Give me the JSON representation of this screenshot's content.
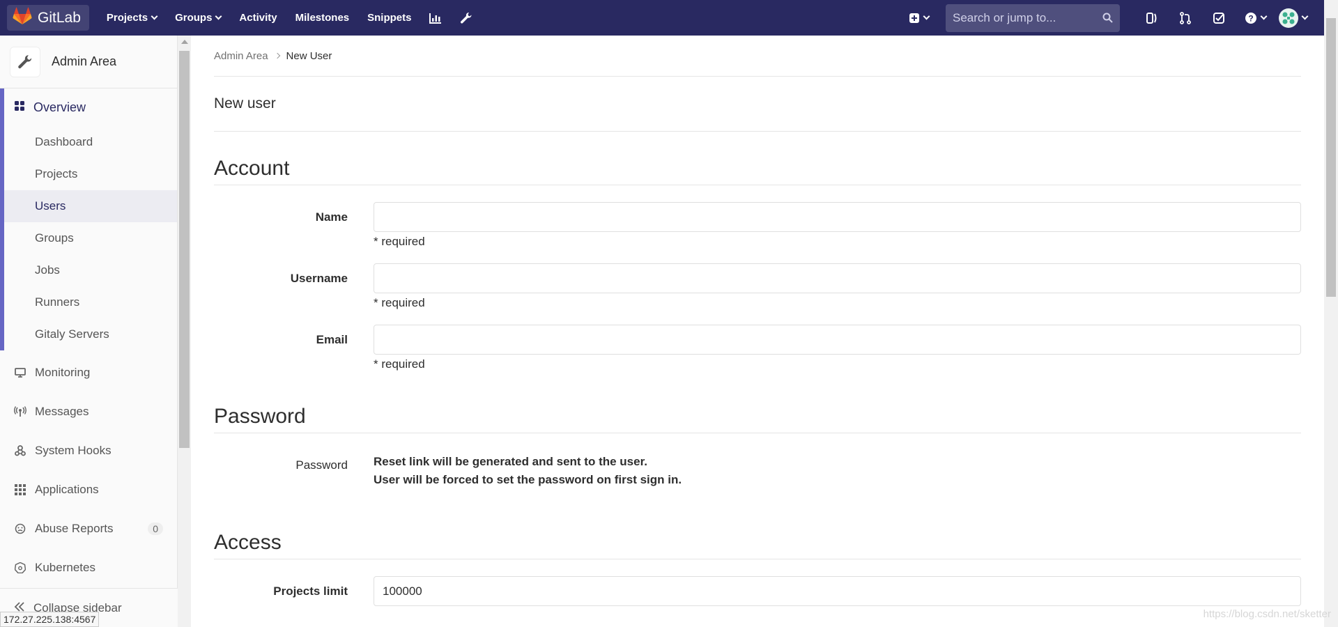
{
  "topbar": {
    "brand": "GitLab",
    "nav": [
      {
        "label": "Projects",
        "dropdown": true
      },
      {
        "label": "Groups",
        "dropdown": true
      },
      {
        "label": "Activity",
        "dropdown": false
      },
      {
        "label": "Milestones",
        "dropdown": false
      },
      {
        "label": "Snippets",
        "dropdown": false
      }
    ],
    "search_placeholder": "Search or jump to...",
    "colors": {
      "bg": "#292961",
      "brand_orange": "#e24329"
    }
  },
  "sidebar": {
    "title": "Admin Area",
    "overview_label": "Overview",
    "sub_items": [
      "Dashboard",
      "Projects",
      "Users",
      "Groups",
      "Jobs",
      "Runners",
      "Gitaly Servers"
    ],
    "active_sub": "Users",
    "items": [
      {
        "label": "Monitoring",
        "icon": "monitor-icon"
      },
      {
        "label": "Messages",
        "icon": "broadcast-icon"
      },
      {
        "label": "System Hooks",
        "icon": "hook-icon"
      },
      {
        "label": "Applications",
        "icon": "grid-icon"
      },
      {
        "label": "Abuse Reports",
        "icon": "face-icon",
        "badge": "0"
      },
      {
        "label": "Kubernetes",
        "icon": "kubernetes-icon"
      }
    ],
    "collapse_label": "Collapse sidebar"
  },
  "status_url": "172.27.225.138:4567",
  "breadcrumb": {
    "parent": "Admin Area",
    "current": "New User"
  },
  "page_title": "New user",
  "account": {
    "heading": "Account",
    "name_label": "Name",
    "username_label": "Username",
    "email_label": "Email",
    "required_text": "* required"
  },
  "password": {
    "heading": "Password",
    "label": "Password",
    "line1": "Reset link will be generated and sent to the user.",
    "line2": "User will be forced to set the password on first sign in."
  },
  "access": {
    "heading": "Access",
    "projects_limit_label": "Projects limit",
    "projects_limit_value": "100000"
  },
  "watermark": "https://blog.csdn.net/sketter"
}
